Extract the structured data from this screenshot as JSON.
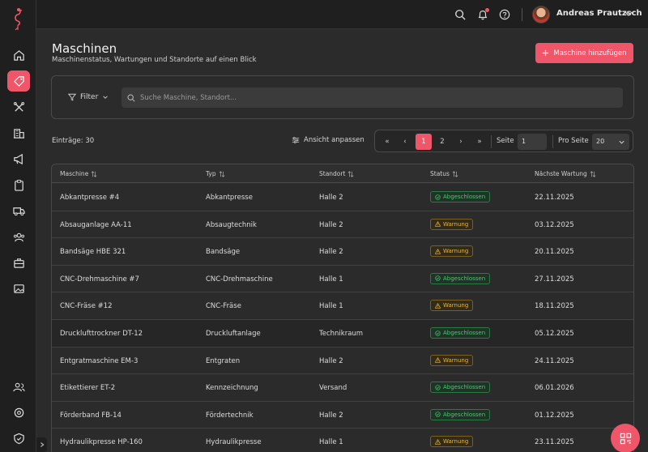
{
  "topbar": {
    "user_name": "Andreas Prautzsch"
  },
  "sidebar": {
    "items": [
      {
        "icon": "home-icon"
      },
      {
        "icon": "tag-icon",
        "active": true
      },
      {
        "icon": "tools-icon"
      },
      {
        "icon": "building-icon"
      },
      {
        "icon": "megaphone-icon"
      },
      {
        "icon": "clipboard-icon"
      },
      {
        "icon": "truck-icon"
      },
      {
        "icon": "team-icon"
      },
      {
        "icon": "briefcase-icon"
      },
      {
        "icon": "image-icon"
      }
    ],
    "bottom_items": [
      {
        "icon": "users-icon"
      },
      {
        "icon": "settings-icon"
      },
      {
        "icon": "shield-icon"
      }
    ]
  },
  "header": {
    "title": "Maschinen",
    "subtitle": "Maschinenstatus, Wartungen und Standorte auf einen Blick",
    "add_button": "Maschine hinzufügen"
  },
  "filter": {
    "label": "Filter",
    "search_placeholder": "Suche Maschine, Standort..."
  },
  "controls": {
    "entries": "Einträge: 30",
    "view_button": "Ansicht anpassen",
    "pages": [
      "1",
      "2"
    ],
    "current_page": "1",
    "page_label": "Seite",
    "page_value": "1",
    "per_page_label": "Pro Seite",
    "per_page_value": "20"
  },
  "table": {
    "columns": [
      "Maschine",
      "Typ",
      "Standort",
      "Status",
      "Nächste Wartung"
    ],
    "rows": [
      {
        "name": "Abkantpresse #4",
        "type": "Abkantpresse",
        "location": "Halle 2",
        "status": "Abgeschlossen",
        "status_kind": "ok",
        "date": "22.11.2025"
      },
      {
        "name": "Absauganlage AA-11",
        "type": "Absaugtechnik",
        "location": "Halle 2",
        "status": "Warnung",
        "status_kind": "warn",
        "date": "03.12.2025"
      },
      {
        "name": "Bandsäge HBE 321",
        "type": "Bandsäge",
        "location": "Halle 2",
        "status": "Warnung",
        "status_kind": "warn",
        "date": "20.11.2025"
      },
      {
        "name": "CNC-Drehmaschine #7",
        "type": "CNC-Drehmaschine",
        "location": "Halle 1",
        "status": "Abgeschlossen",
        "status_kind": "ok",
        "date": "27.11.2025"
      },
      {
        "name": "CNC-Fräse #12",
        "type": "CNC-Fräse",
        "location": "Halle 1",
        "status": "Warnung",
        "status_kind": "warn",
        "date": "18.11.2025"
      },
      {
        "name": "Drucklufttrockner DT-12",
        "type": "Druckluftanlage",
        "location": "Technikraum",
        "status": "Abgeschlossen",
        "status_kind": "ok",
        "date": "05.12.2025"
      },
      {
        "name": "Entgratmaschine EM-3",
        "type": "Entgraten",
        "location": "Halle 2",
        "status": "Warnung",
        "status_kind": "warn",
        "date": "24.11.2025"
      },
      {
        "name": "Etikettierer ET-2",
        "type": "Kennzeichnung",
        "location": "Versand",
        "status": "Abgeschlossen",
        "status_kind": "ok",
        "date": "06.01.2026"
      },
      {
        "name": "Förderband FB-14",
        "type": "Fördertechnik",
        "location": "Halle 2",
        "status": "Abgeschlossen",
        "status_kind": "ok",
        "date": "01.12.2025"
      },
      {
        "name": "Hydraulikpresse HP-160",
        "type": "Hydraulikpresse",
        "location": "Halle 1",
        "status": "Warnung",
        "status_kind": "warn",
        "date": "23.11.2025"
      }
    ]
  },
  "colors": {
    "accent": "#f0566a",
    "ok": "#3fcf6b",
    "warn": "#e6b43a",
    "background": "#2b2b2b"
  }
}
